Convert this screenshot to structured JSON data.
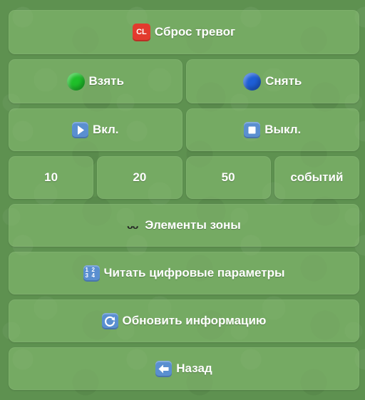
{
  "buttons": {
    "reset_alarms": {
      "label": "Сброс тревог",
      "icon": "cl-icon",
      "icon_text": "CL",
      "color": "#e23b2e"
    },
    "arm": {
      "label": "Взять",
      "icon": "green-circle-icon",
      "color": "#1fbf2a"
    },
    "disarm": {
      "label": "Снять",
      "icon": "blue-circle-icon",
      "color": "#1e5fd6"
    },
    "on": {
      "label": "Вкл.",
      "icon": "play-icon"
    },
    "off": {
      "label": "Выкл.",
      "icon": "stop-icon"
    },
    "events": [
      {
        "label": "10"
      },
      {
        "label": "20"
      },
      {
        "label": "50"
      },
      {
        "label": "событий"
      }
    ],
    "zone_elements": {
      "label": "Элементы зоны",
      "icon": "loops-icon",
      "icon_text": "ᴗᴗ"
    },
    "read_params": {
      "label": "Читать цифровые параметры",
      "icon": "numbers-icon",
      "icon_digits": [
        "1",
        "2",
        "3",
        "4"
      ]
    },
    "refresh": {
      "label": "Обновить информацию",
      "icon": "refresh-icon"
    },
    "back": {
      "label": "Назад",
      "icon": "back-arrow-icon"
    }
  },
  "colors": {
    "background": "#5e9150",
    "button": "#84ba70",
    "text": "#ffffff",
    "icon_blue": "#5a8fd0"
  }
}
